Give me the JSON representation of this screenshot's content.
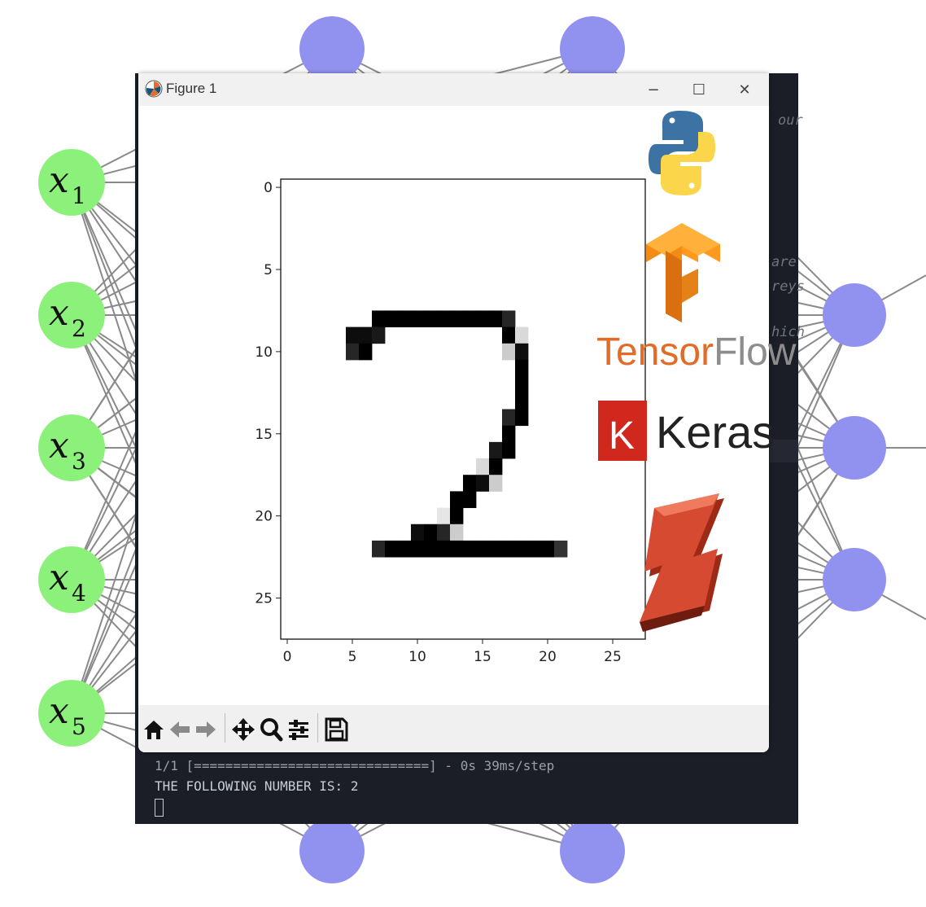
{
  "background": {
    "input_nodes": [
      {
        "var": "x",
        "sub": "1"
      },
      {
        "var": "x",
        "sub": "2"
      },
      {
        "var": "x",
        "sub": "3"
      },
      {
        "var": "x",
        "sub": "4"
      },
      {
        "var": "x",
        "sub": "5"
      }
    ],
    "colors": {
      "input": "#8cf17a",
      "hidden": "#9191f0",
      "edge": "#8a8a8a"
    }
  },
  "terminal": {
    "faint_fragments": [
      "our",
      "are",
      "reys",
      "hich"
    ],
    "progress_counter": "1/1",
    "progress_bar": "[==============================]",
    "progress_stats": " - 0s 39ms/step",
    "result_line": "THE FOLLOWING NUMBER IS: 2"
  },
  "window": {
    "title": "Figure 1",
    "controls": {
      "minimize": "−",
      "maximize": "☐",
      "close": "✕"
    },
    "toolbar": [
      "home-icon",
      "back-icon",
      "forward-icon",
      "pan-icon",
      "zoom-icon",
      "configure-subplots-icon",
      "save-icon"
    ]
  },
  "chart_data": {
    "type": "heatmap",
    "colormap": "binary",
    "rows": 28,
    "cols": 28,
    "x_ticks": [
      "0",
      "5",
      "10",
      "15",
      "20",
      "25"
    ],
    "y_ticks": [
      "0",
      "5",
      "10",
      "15",
      "20",
      "25"
    ],
    "pixels": [
      [
        7,
        8,
        1.0
      ],
      [
        8,
        8,
        1.0
      ],
      [
        9,
        8,
        1.0
      ],
      [
        10,
        8,
        1.0
      ],
      [
        11,
        8,
        1.0
      ],
      [
        12,
        8,
        1.0
      ],
      [
        13,
        8,
        1.0
      ],
      [
        14,
        8,
        1.0
      ],
      [
        15,
        8,
        1.0
      ],
      [
        16,
        8,
        1.0
      ],
      [
        17,
        8,
        0.85
      ],
      [
        5,
        9,
        0.95
      ],
      [
        6,
        9,
        0.95
      ],
      [
        7,
        9,
        0.9
      ],
      [
        17,
        9,
        1.0
      ],
      [
        18,
        9,
        0.15
      ],
      [
        5,
        10,
        0.85
      ],
      [
        6,
        10,
        1.0
      ],
      [
        17,
        10,
        0.2
      ],
      [
        18,
        10,
        0.95
      ],
      [
        18,
        11,
        1.0
      ],
      [
        18,
        12,
        1.0
      ],
      [
        18,
        13,
        1.0
      ],
      [
        17,
        14,
        0.85
      ],
      [
        18,
        14,
        1.0
      ],
      [
        17,
        15,
        1.0
      ],
      [
        16,
        16,
        0.9
      ],
      [
        17,
        16,
        1.0
      ],
      [
        15,
        17,
        0.15
      ],
      [
        16,
        17,
        1.0
      ],
      [
        14,
        18,
        1.0
      ],
      [
        15,
        18,
        0.95
      ],
      [
        16,
        18,
        0.2
      ],
      [
        13,
        19,
        1.0
      ],
      [
        14,
        19,
        1.0
      ],
      [
        12,
        20,
        0.1
      ],
      [
        13,
        20,
        1.0
      ],
      [
        10,
        21,
        0.95
      ],
      [
        11,
        21,
        1.0
      ],
      [
        12,
        21,
        0.85
      ],
      [
        13,
        21,
        0.2
      ],
      [
        7,
        22,
        0.85
      ],
      [
        8,
        22,
        1.0
      ],
      [
        9,
        22,
        1.0
      ],
      [
        10,
        22,
        1.0
      ],
      [
        11,
        22,
        1.0
      ],
      [
        12,
        22,
        1.0
      ],
      [
        13,
        22,
        1.0
      ],
      [
        14,
        22,
        1.0
      ],
      [
        15,
        22,
        1.0
      ],
      [
        16,
        22,
        1.0
      ],
      [
        17,
        22,
        1.0
      ],
      [
        18,
        22,
        1.0
      ],
      [
        19,
        22,
        1.0
      ],
      [
        20,
        22,
        1.0
      ],
      [
        21,
        22,
        0.8
      ]
    ]
  },
  "logos": {
    "tensorflow_text": "TensorFlow",
    "tensorflow_part1": "Tensor",
    "tensorflow_part2": "Flow",
    "keras_badge": "K",
    "keras_text": "Keras"
  }
}
